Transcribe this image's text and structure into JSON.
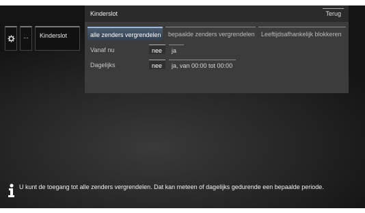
{
  "nav": {
    "gear_icon": "gear-icon",
    "more_label": "...",
    "kinderslot_label": "Kinderslot"
  },
  "panel": {
    "title": "Kinderslot",
    "back_label": "Terug",
    "tabs": [
      {
        "label": "alle zenders vergrendelen",
        "active": true
      },
      {
        "label": "bepaalde zenders vergrendelen",
        "active": false
      },
      {
        "label": "Leeftijdsafhankelijk blokkeren",
        "active": false
      }
    ],
    "rows": [
      {
        "label": "Vanaf nu",
        "options": [
          {
            "label": "nee",
            "selected": true
          },
          {
            "label": "ja",
            "selected": false
          }
        ]
      },
      {
        "label": "Dagelijks",
        "options": [
          {
            "label": "nee",
            "selected": true
          },
          {
            "label": "ja, van 00:00 tot 00:00",
            "selected": false
          }
        ]
      }
    ]
  },
  "info": {
    "icon": "info-icon",
    "text": "U kunt de toegang tot alle zenders vergrendelen. Dat kan meteen of dagelijks gedurende een bepaalde periode."
  },
  "colors": {
    "active_tab": "#4a5a70",
    "panel_bg": "#3c3c3c",
    "screen_bg": "#262626"
  }
}
